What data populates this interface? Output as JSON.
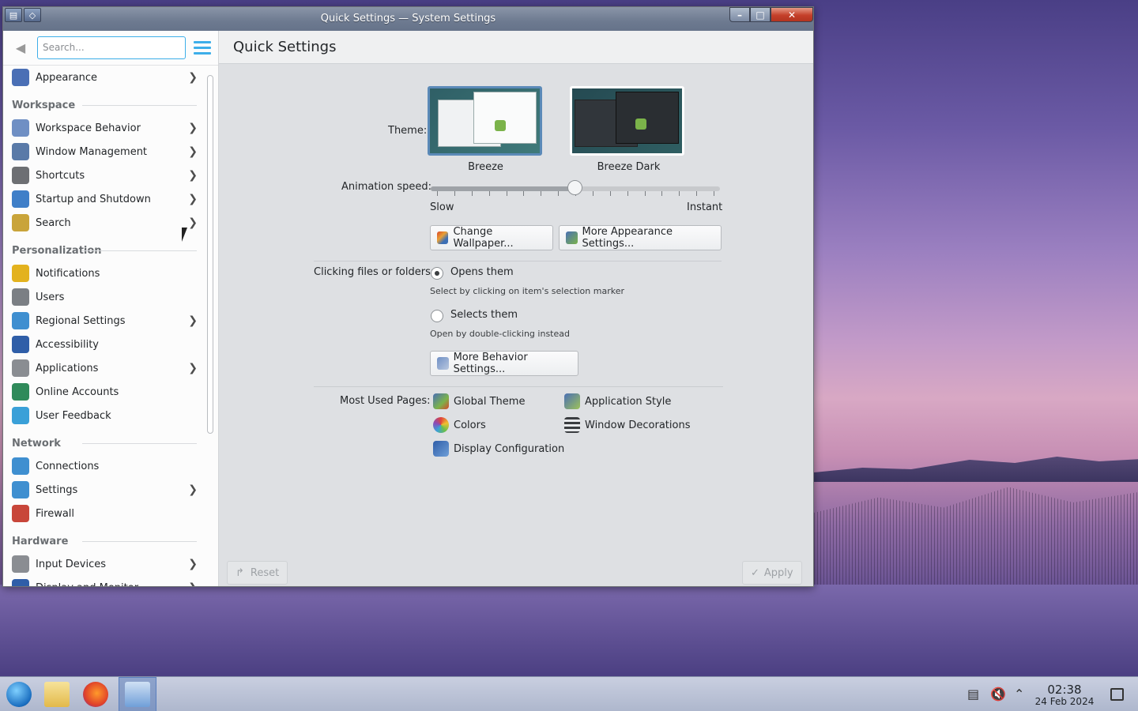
{
  "window": {
    "title": "Quick Settings — System Settings"
  },
  "sidebar": {
    "search_placeholder": "Search...",
    "items": [
      {
        "type": "item",
        "label": "Appearance",
        "chevron": true,
        "icon": "appearance-icon",
        "color": "#4a6fb5"
      },
      {
        "type": "section",
        "label": "Workspace"
      },
      {
        "type": "item",
        "label": "Workspace Behavior",
        "chevron": true,
        "icon": "workspace-behavior-icon",
        "color": "#6f8fc4"
      },
      {
        "type": "item",
        "label": "Window Management",
        "chevron": true,
        "icon": "window-management-icon",
        "color": "#5a7aa8"
      },
      {
        "type": "item",
        "label": "Shortcuts",
        "chevron": true,
        "icon": "keyboard-icon",
        "color": "#6d6f73"
      },
      {
        "type": "item",
        "label": "Startup and Shutdown",
        "chevron": true,
        "icon": "startup-icon",
        "color": "#3f7fc8"
      },
      {
        "type": "item",
        "label": "Search",
        "chevron": true,
        "icon": "search-icon",
        "color": "#c9a43a"
      },
      {
        "type": "section",
        "label": "Personalization"
      },
      {
        "type": "item",
        "label": "Notifications",
        "chevron": false,
        "icon": "bell-icon",
        "color": "#e3b21e"
      },
      {
        "type": "item",
        "label": "Users",
        "chevron": false,
        "icon": "users-icon",
        "color": "#7b7f84"
      },
      {
        "type": "item",
        "label": "Regional Settings",
        "chevron": true,
        "icon": "globe-icon",
        "color": "#3f8fd0"
      },
      {
        "type": "item",
        "label": "Accessibility",
        "chevron": false,
        "icon": "accessibility-icon",
        "color": "#2f5ea8"
      },
      {
        "type": "item",
        "label": "Applications",
        "chevron": true,
        "icon": "applications-icon",
        "color": "#8a8d92"
      },
      {
        "type": "item",
        "label": "Online Accounts",
        "chevron": false,
        "icon": "online-accounts-icon",
        "color": "#2f8a5a"
      },
      {
        "type": "item",
        "label": "User Feedback",
        "chevron": false,
        "icon": "feedback-icon",
        "color": "#3aa0d8"
      },
      {
        "type": "section",
        "label": "Network"
      },
      {
        "type": "item",
        "label": "Connections",
        "chevron": false,
        "icon": "connections-icon",
        "color": "#3f8fd0"
      },
      {
        "type": "item",
        "label": "Settings",
        "chevron": true,
        "icon": "network-settings-icon",
        "color": "#3f8fd0"
      },
      {
        "type": "item",
        "label": "Firewall",
        "chevron": false,
        "icon": "firewall-icon",
        "color": "#c8463a"
      },
      {
        "type": "section",
        "label": "Hardware"
      },
      {
        "type": "item",
        "label": "Input Devices",
        "chevron": true,
        "icon": "input-devices-icon",
        "color": "#8a8d92"
      },
      {
        "type": "item",
        "label": "Display and Monitor",
        "chevron": true,
        "icon": "display-icon",
        "color": "#2f5ea8"
      }
    ]
  },
  "main": {
    "heading": "Quick Settings",
    "theme_label": "Theme:",
    "themes": [
      {
        "name": "Breeze",
        "selected": true
      },
      {
        "name": "Breeze Dark",
        "selected": false
      }
    ],
    "animation_label": "Animation speed:",
    "animation_slow": "Slow",
    "animation_instant": "Instant",
    "animation_value_fraction": 0.5,
    "change_wallpaper": "Change Wallpaper...",
    "more_appearance": "More Appearance Settings...",
    "clicking_label": "Clicking files or folders:",
    "opens_them": "Opens them",
    "opens_hint": "Select by clicking on item's selection marker",
    "selects_them": "Selects them",
    "selects_hint": "Open by double-clicking instead",
    "more_behavior": "More Behavior Settings...",
    "most_used_label": "Most Used Pages:",
    "most_used": [
      {
        "label": "Global Theme",
        "icon": "global-theme-icon"
      },
      {
        "label": "Application Style",
        "icon": "application-style-icon"
      },
      {
        "label": "Colors",
        "icon": "colors-icon"
      },
      {
        "label": "Window Decorations",
        "icon": "window-decorations-icon"
      },
      {
        "label": "Display Configuration",
        "icon": "display-configuration-icon"
      }
    ],
    "reset": "Reset",
    "apply": "Apply"
  },
  "taskbar": {
    "time": "02:38",
    "date": "24 Feb 2024"
  },
  "colors": {
    "accent": "#3daee9",
    "titlebar": "#6d7a90",
    "close": "#c4402a"
  }
}
